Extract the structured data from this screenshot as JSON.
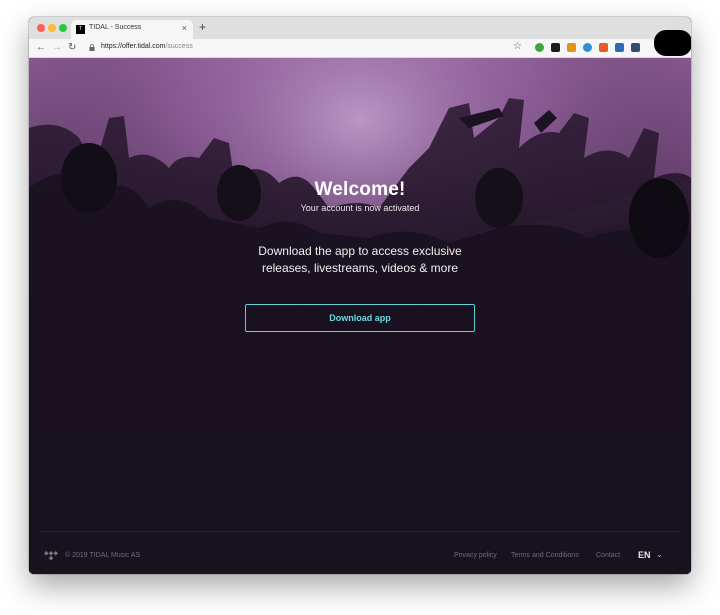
{
  "browser": {
    "tab_title": "TIDAL - Success",
    "favicon_text": "T",
    "close_glyph": "×",
    "new_tab_glyph": "+",
    "url_host": "https://offer.tidal.com",
    "url_path": "/success",
    "nav_icons": [
      "back-arrow-icon",
      "forward-arrow-icon",
      "reload-icon",
      "lock-icon",
      "star-icon"
    ],
    "extension_colors": [
      "#3fa53a",
      "#1b1b1b",
      "#e7901a",
      "#2d8fd5",
      "#e95c21",
      "#2c6bb5",
      "#344a6e"
    ]
  },
  "hero": {
    "title": "Welcome!",
    "subtitle": "Your account is now activated",
    "cta_line1": "Download the app to access exclusive",
    "cta_line2": "releases, livestreams, videos & more",
    "button_label": "Download app"
  },
  "footer": {
    "copyright": "© 2019 TIDAL Music AS",
    "privacy": "Privacy policy",
    "terms": "Terms and Conditions",
    "contact": "Contact",
    "language": "EN"
  },
  "colors": {
    "accent": "#69dbe0",
    "hero_purple": "#7a4d86",
    "background": "#0a0a0e"
  }
}
